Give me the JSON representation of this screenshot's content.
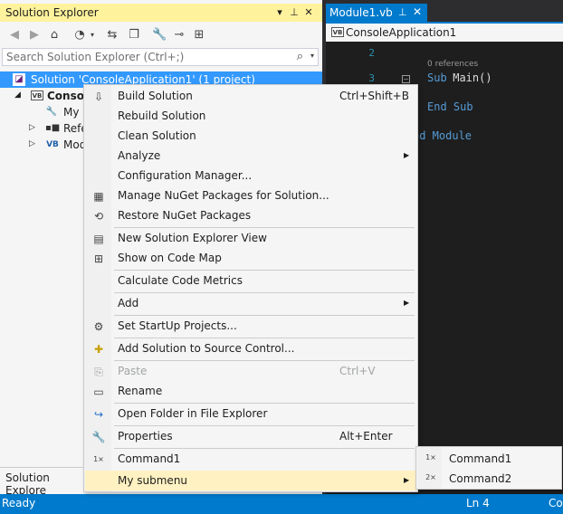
{
  "solution_explorer": {
    "title": "Solution Explorer",
    "search_placeholder": "Search Solution Explorer (Ctrl+;)",
    "tree": {
      "solution": "Solution 'ConsoleApplication1' (1 project)",
      "project": "Console",
      "my_project": "My",
      "references": "Refe",
      "module": "Mod"
    },
    "bottom_tab": "Solution Explore"
  },
  "editor": {
    "tab_title": "Module1.vb",
    "nav_scope": "ConsoleApplication1",
    "lines": [
      {
        "num": "2"
      },
      {
        "num": "3"
      }
    ],
    "references": "0 references",
    "code_sub": "Sub",
    "code_main": " Main()",
    "code_end_sub": "End Sub",
    "code_end_module": "nd Module"
  },
  "context_menu": {
    "items": [
      {
        "label": "Build Solution",
        "shortcut": "Ctrl+Shift+B",
        "icon": "build-icon"
      },
      {
        "label": "Rebuild Solution",
        "shortcut": "",
        "icon": ""
      },
      {
        "label": "Clean Solution",
        "shortcut": "",
        "icon": ""
      },
      {
        "label": "Analyze",
        "shortcut": "",
        "icon": "",
        "submenu": true
      },
      {
        "label": "Configuration Manager...",
        "shortcut": "",
        "icon": ""
      },
      {
        "label": "Manage NuGet Packages for Solution...",
        "shortcut": "",
        "icon": "nuget-icon"
      },
      {
        "label": "Restore NuGet Packages",
        "shortcut": "",
        "icon": "restore-icon"
      },
      {
        "label": "New Solution Explorer View",
        "shortcut": "",
        "icon": "new-view-icon"
      },
      {
        "label": "Show on Code Map",
        "shortcut": "",
        "icon": "code-map-icon"
      },
      {
        "label": "Calculate Code Metrics",
        "shortcut": "",
        "icon": ""
      },
      {
        "label": "Add",
        "shortcut": "",
        "icon": "",
        "submenu": true
      },
      {
        "label": "Set StartUp Projects...",
        "shortcut": "",
        "icon": "gear-icon"
      },
      {
        "label": "Add Solution to Source Control...",
        "shortcut": "",
        "icon": "source-control-icon"
      },
      {
        "label": "Paste",
        "shortcut": "Ctrl+V",
        "icon": "paste-icon",
        "disabled": true
      },
      {
        "label": "Rename",
        "shortcut": "",
        "icon": "rename-icon"
      },
      {
        "label": "Open Folder in File Explorer",
        "shortcut": "",
        "icon": "open-folder-icon"
      },
      {
        "label": "Properties",
        "shortcut": "Alt+Enter",
        "icon": "wrench-icon"
      },
      {
        "label": "Command1",
        "shortcut": "",
        "icon": "command1-icon"
      },
      {
        "label": "My submenu",
        "shortcut": "",
        "icon": "",
        "submenu": true,
        "highlighted": true
      }
    ],
    "command_icon_text": "1×"
  },
  "submenu": {
    "items": [
      {
        "label": "Command1",
        "icon_text": "1×"
      },
      {
        "label": "Command2",
        "icon_text": "2×"
      }
    ]
  },
  "status_bar": {
    "ready": "Ready",
    "line": "Ln 4",
    "col": "Co"
  },
  "colors": {
    "accent": "#007acc",
    "title_highlight": "#fff29d",
    "menu_highlight": "#fff1c2",
    "selection": "#3399ff"
  }
}
